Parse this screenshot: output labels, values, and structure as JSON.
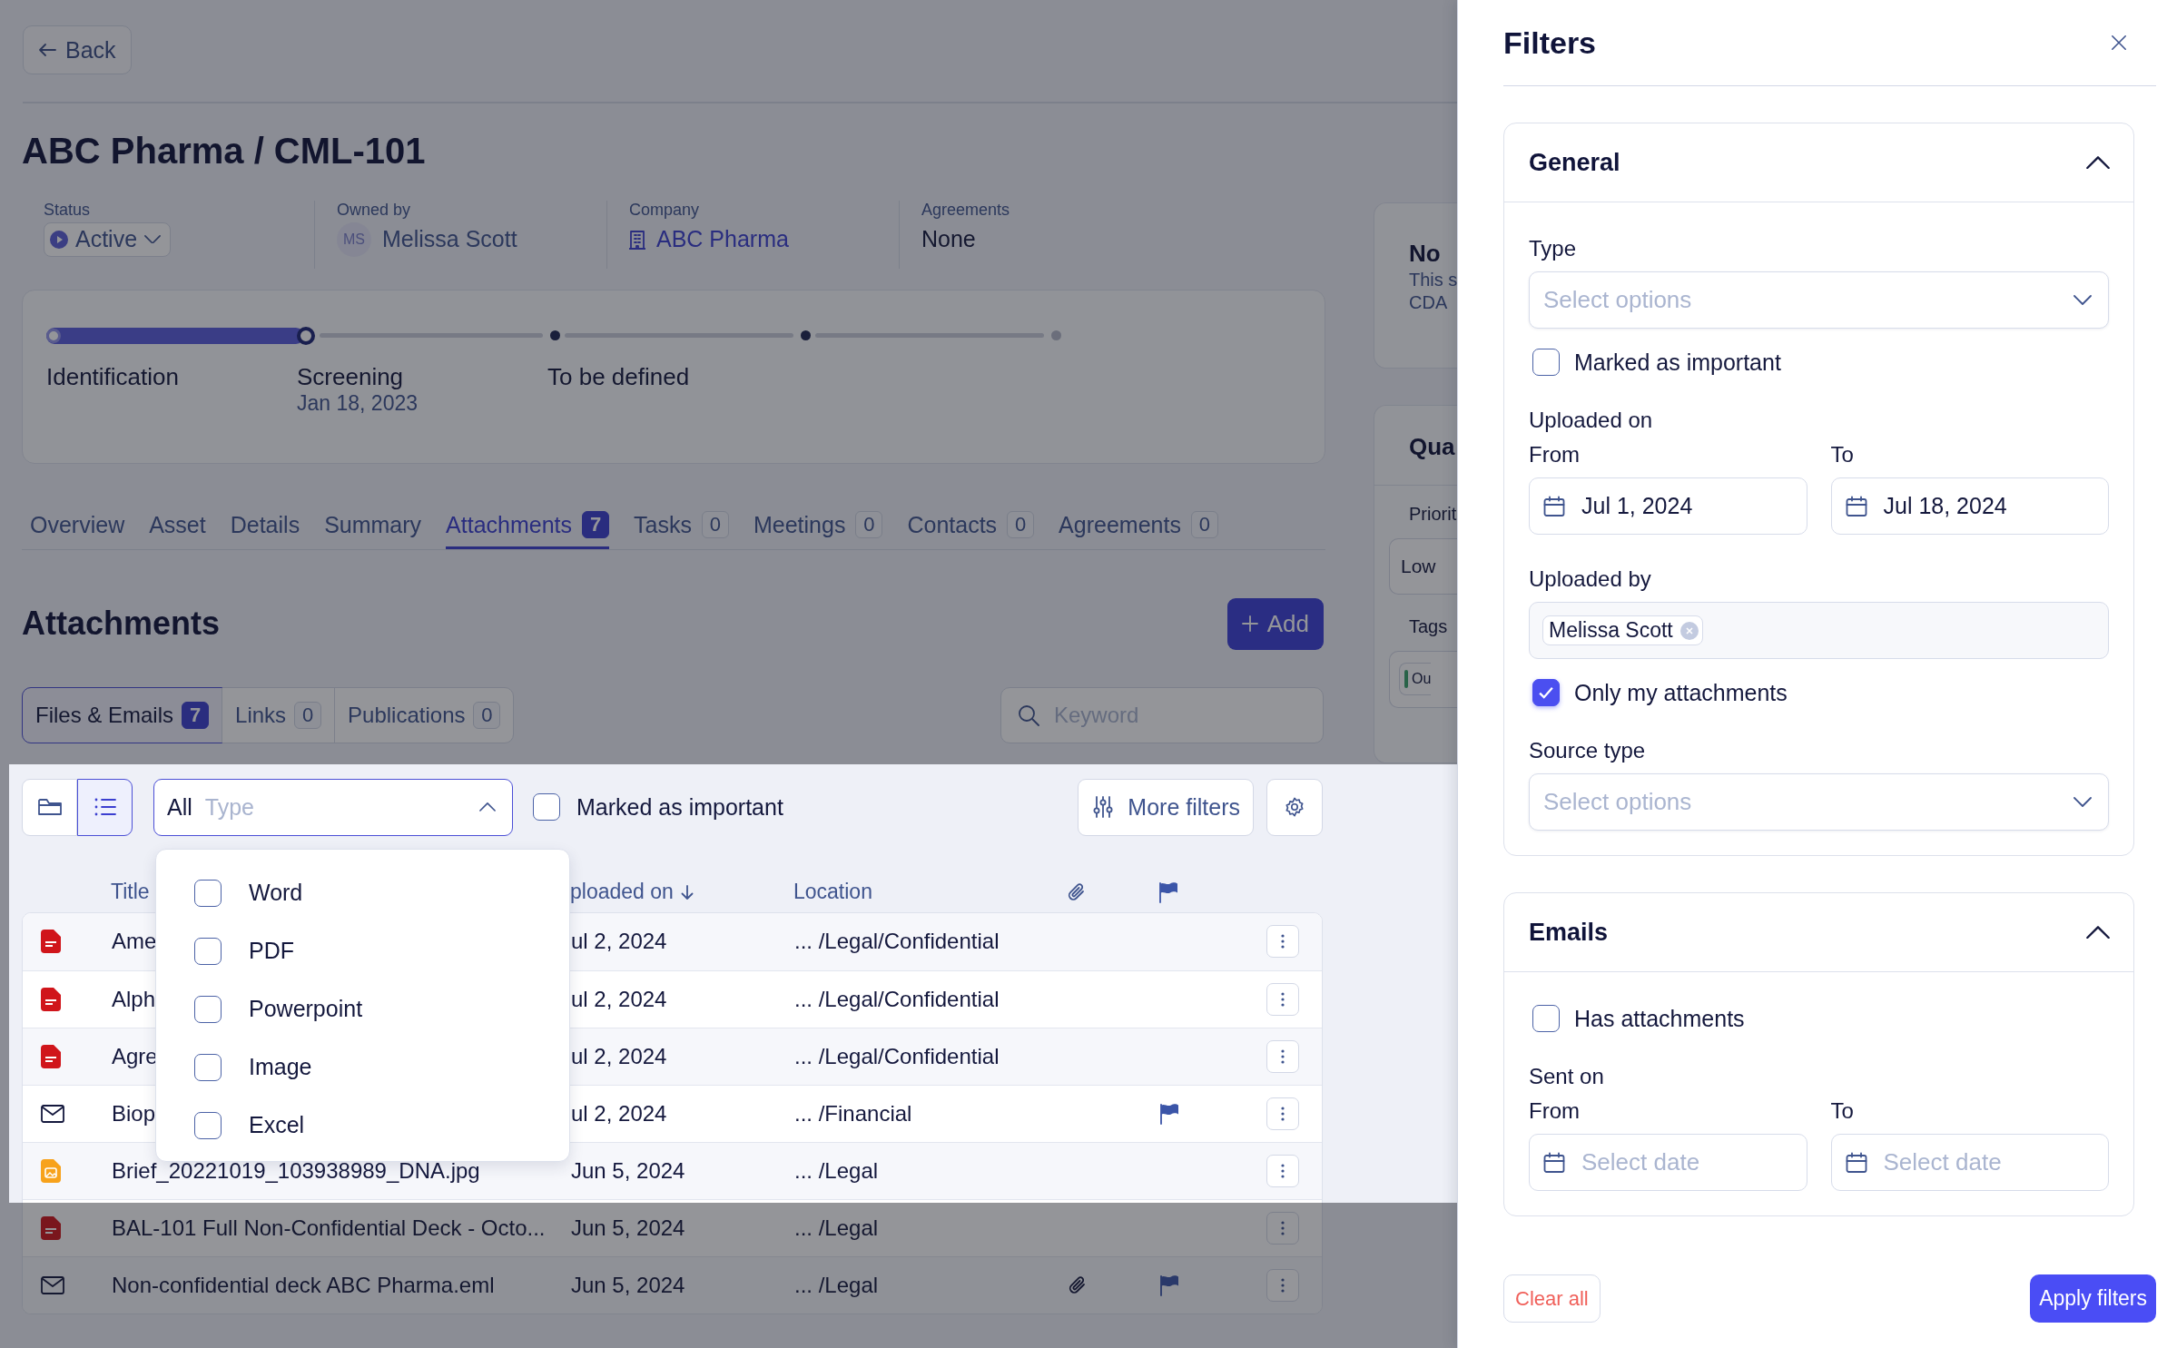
{
  "back_button": "Back",
  "title": "ABC Pharma / CML-101",
  "meta": {
    "status": {
      "label": "Status",
      "value": "Active"
    },
    "owned_by": {
      "label": "Owned by",
      "initials": "MS",
      "value": "Melissa Scott"
    },
    "company": {
      "label": "Company",
      "value": "ABC Pharma"
    },
    "agreements": {
      "label": "Agreements",
      "value": "None"
    }
  },
  "progress": {
    "steps": [
      {
        "label": "Identification",
        "done": true,
        "current": false
      },
      {
        "label": "Screening",
        "date": "Jan 18, 2023",
        "done": false,
        "current": true
      },
      {
        "label": "To be defined",
        "done": false,
        "current": false
      },
      {
        "done": false,
        "current": false
      },
      {
        "done": false,
        "current": false
      }
    ]
  },
  "tabs": [
    {
      "label": "Overview",
      "selected": false
    },
    {
      "label": "Asset",
      "selected": false
    },
    {
      "label": "Details",
      "selected": false
    },
    {
      "label": "Summary",
      "selected": false
    },
    {
      "label": "Attachments",
      "count": "7",
      "selected": true
    },
    {
      "label": "Tasks",
      "count": "0",
      "selected": false
    },
    {
      "label": "Meetings",
      "count": "0",
      "selected": false
    },
    {
      "label": "Contacts",
      "count": "0",
      "selected": false
    },
    {
      "label": "Agreements",
      "count": "0",
      "selected": false
    }
  ],
  "attachments": {
    "title": "Attachments",
    "add_button": "Add",
    "subtabs": [
      {
        "label": "Files & Emails",
        "count": "7",
        "selected": true
      },
      {
        "label": "Links",
        "count": "0",
        "selected": false
      },
      {
        "label": "Publications",
        "count": "0",
        "selected": false
      }
    ],
    "search": {
      "placeholder": "Keyword"
    },
    "view_toggle": [
      {
        "kind": "folder",
        "selected": false
      },
      {
        "kind": "list",
        "selected": true
      }
    ],
    "type_select": {
      "value": "All",
      "placeholder": "Type",
      "expanded": true
    },
    "important": {
      "label": "Marked as important",
      "checked": false
    },
    "more_filters": "More filters",
    "type_options": [
      {
        "label": "Word",
        "checked": false
      },
      {
        "label": "PDF",
        "checked": false
      },
      {
        "label": "Powerpoint",
        "checked": false
      },
      {
        "label": "Image",
        "checked": false
      },
      {
        "label": "Excel",
        "checked": false
      }
    ],
    "table": {
      "columns": [
        "Title",
        "ploaded on",
        "Location"
      ],
      "rows": [
        {
          "kind": "pdf",
          "title": "Ame",
          "uploaded_on": "ul 2, 2024",
          "location": "... /Legal/Confidential",
          "attachment": false,
          "flagged": false
        },
        {
          "kind": "pdf",
          "title": "Alph",
          "uploaded_on": "ul 2, 2024",
          "location": "... /Legal/Confidential",
          "attachment": false,
          "flagged": false
        },
        {
          "kind": "pdf",
          "title": "Agre",
          "uploaded_on": "ul 2, 2024",
          "location": "... /Legal/Confidential",
          "attachment": false,
          "flagged": false
        },
        {
          "kind": "email",
          "title": "Biop",
          "uploaded_on": "ul 2, 2024",
          "location": "... /Financial",
          "attachment": false,
          "flagged": true
        },
        {
          "kind": "image",
          "title": "Brief_20221019_103938989_DNA.jpg",
          "uploaded_on": "Jun 5, 2024",
          "location": "... /Legal",
          "attachment": false,
          "flagged": false
        },
        {
          "kind": "pdf",
          "title": "BAL-101 Full Non-Confidential Deck - Octo...",
          "uploaded_on": "Jun 5, 2024",
          "location": "... /Legal",
          "attachment": false,
          "flagged": false
        },
        {
          "kind": "email",
          "title": "Non-confidential deck ABC Pharma.eml",
          "uploaded_on": "Jun 5, 2024",
          "location": "... /Legal",
          "attachment": true,
          "flagged": true
        }
      ]
    }
  },
  "side_cards": {
    "card_1": {
      "title": "No",
      "text": [
        "This s",
        "CDA"
      ]
    },
    "card_2": {
      "title": "Qua",
      "priority_label": "Priorit",
      "priority_value": "Low",
      "tags_label": "Tags",
      "tag": "Ou"
    }
  },
  "filters": {
    "title": "Filters",
    "sections": [
      {
        "title": "General",
        "expanded": true,
        "fields": [
          {
            "kind": "select",
            "label": "Type",
            "placeholder": "Select options"
          },
          {
            "kind": "checkbox",
            "label": "Marked as important",
            "checked": false
          },
          {
            "kind": "daterange",
            "label": "Uploaded on",
            "from": {
              "label": "From",
              "value": "Jul 1, 2024"
            },
            "to": {
              "label": "To",
              "value": "Jul 18, 2024"
            }
          },
          {
            "kind": "tags",
            "label": "Uploaded by",
            "tags": [
              "Melissa Scott"
            ]
          },
          {
            "kind": "checkbox",
            "label": "Only my attachments",
            "checked": true
          },
          {
            "kind": "select",
            "label": "Source type",
            "placeholder": "Select options"
          }
        ]
      },
      {
        "title": "Emails",
        "expanded": true,
        "fields": [
          {
            "kind": "checkbox",
            "label": "Has attachments",
            "checked": false
          },
          {
            "kind": "daterange",
            "label": "Sent on",
            "from": {
              "label": "From",
              "placeholder": "Select date"
            },
            "to": {
              "label": "To",
              "placeholder": "Select date"
            }
          }
        ]
      }
    ],
    "clear_button": "Clear all",
    "apply_button": "Apply filters"
  }
}
